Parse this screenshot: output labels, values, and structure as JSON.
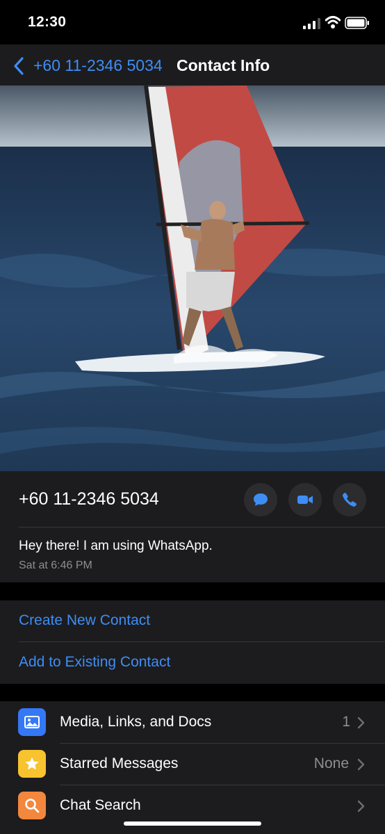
{
  "status_bar": {
    "time": "12:30"
  },
  "nav": {
    "back_label": "+60 11-2346 5034",
    "title": "Contact Info"
  },
  "contact": {
    "phone": "+60 11-2346 5034",
    "about": "Hey there! I am using WhatsApp.",
    "about_date": "Sat at 6:46 PM"
  },
  "actions": {
    "create_new_contact": "Create New Contact",
    "add_to_existing_contact": "Add to Existing Contact"
  },
  "rows": [
    {
      "label": "Media, Links, and Docs",
      "value": "1",
      "icon": "photo-icon",
      "color": "#3478f6"
    },
    {
      "label": "Starred Messages",
      "value": "None",
      "icon": "star-icon",
      "color": "#f7c32e"
    },
    {
      "label": "Chat Search",
      "value": "",
      "icon": "search-icon",
      "color": "#f2873d"
    }
  ],
  "colors": {
    "accent": "#3e8df5",
    "background": "#000000",
    "surface": "#1c1c1e"
  }
}
